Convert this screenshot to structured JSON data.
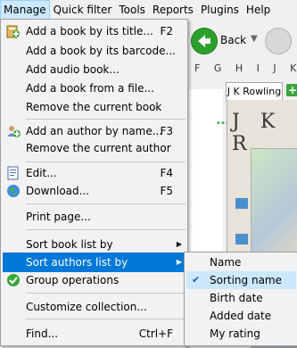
{
  "menubar": {
    "items": [
      "Manage",
      "Quick filter",
      "Tools",
      "Reports",
      "Plugins",
      "Help"
    ]
  },
  "toolbar": {
    "back_label": "Back"
  },
  "alphabet": "F G H I J K",
  "tab": {
    "label": "J K Rowling"
  },
  "author_heading": "J K R",
  "manage_menu": {
    "items": [
      {
        "label": "Add a book by its title...",
        "shortcut": "F2"
      },
      {
        "label": "Add a book by its barcode...",
        "shortcut": ""
      },
      {
        "label": "Add audio book...",
        "shortcut": ""
      },
      {
        "label": "Add a book from a file...",
        "shortcut": ""
      },
      {
        "label": "Remove the current book",
        "shortcut": ""
      },
      {
        "label": "Add an author by name...",
        "shortcut": "F3"
      },
      {
        "label": "Remove the current author",
        "shortcut": ""
      },
      {
        "label": "Edit...",
        "shortcut": "F4"
      },
      {
        "label": "Download...",
        "shortcut": "F5"
      },
      {
        "label": "Print page...",
        "shortcut": ""
      },
      {
        "label": "Sort book list by",
        "shortcut": ""
      },
      {
        "label": "Sort authors list by",
        "shortcut": ""
      },
      {
        "label": "Group operations",
        "shortcut": ""
      },
      {
        "label": "Customize collection...",
        "shortcut": ""
      },
      {
        "label": "Find...",
        "shortcut": "Ctrl+F"
      }
    ]
  },
  "sort_submenu": {
    "items": [
      {
        "label": "Name",
        "checked": false
      },
      {
        "label": "Sorting name",
        "checked": true
      },
      {
        "label": "Birth date",
        "checked": false
      },
      {
        "label": "Added date",
        "checked": false
      },
      {
        "label": "My rating",
        "checked": false
      }
    ]
  },
  "colors": {
    "highlight": "#0078d7",
    "menu_bg": "#f2f2f2",
    "checked_bg": "#cce8ff",
    "back_button": "#2ca02c"
  }
}
